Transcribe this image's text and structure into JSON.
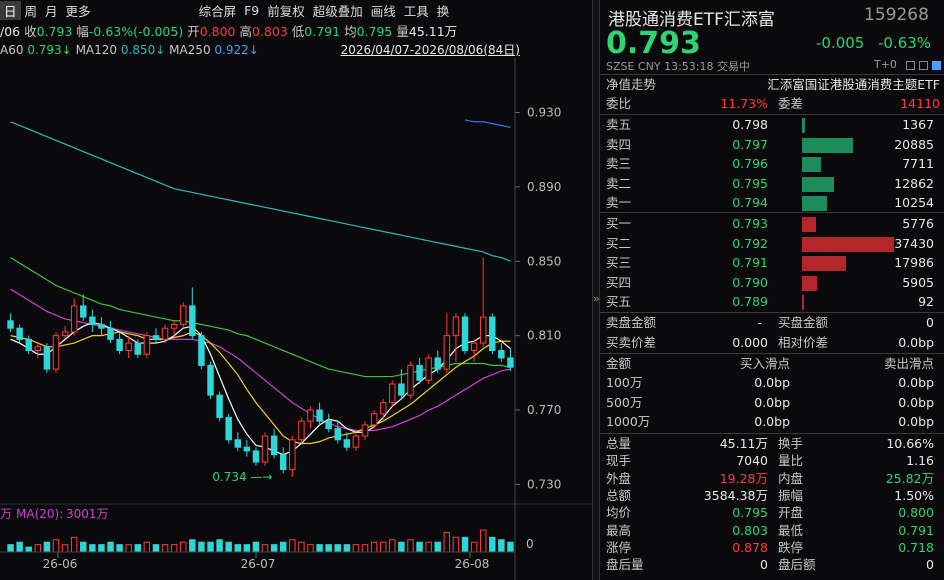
{
  "toolbar": {
    "period_day": "日",
    "period_week": "周",
    "period_month": "月",
    "more": "更多",
    "date_prefix": "/06",
    "close_label": "收",
    "close": "0.793",
    "change_label": "幅",
    "change": "-0.63%(-0.005)",
    "open_label": "开",
    "open": "0.800",
    "high_label": "高",
    "high": "0.803",
    "low_label": "低",
    "low": "0.791",
    "avg_label": "均",
    "avg": "0.795",
    "vol_label": "量",
    "vol": "45.11万",
    "swap": "换",
    "composite": "综合屏",
    "f9": "F9",
    "adjust": "前复权",
    "overlay": "超级叠加",
    "draw": "画线",
    "tools": "工具"
  },
  "ma": {
    "ma60_label": "A60",
    "ma60": "0.793↓",
    "ma120_label": "MA120",
    "ma120": "0.850↓",
    "ma250_label": "MA250",
    "ma250": "0.922↓",
    "range": "2026/04/07-2026/08/06(84日)"
  },
  "yaxis": [
    "0.930",
    "0.890",
    "0.850",
    "0.810",
    "0.770",
    "0.730"
  ],
  "low_marker": "0.734",
  "vol_panel": {
    "unit": "万",
    "ma_label": "MA(20):",
    "ma_value": "3001万",
    "zero": "0"
  },
  "xaxis": [
    "26-06",
    "26-07",
    "26-08"
  ],
  "colors": {
    "up": "#ff3b3b",
    "down": "#2ed7d7",
    "ma5": "#ffffff",
    "ma10": "#f5d020",
    "ma20": "#d040d0",
    "ma60": "#40c040",
    "ma120": "#30b8c0",
    "ma250": "#4070ff"
  },
  "chart_data": {
    "type": "candlestick",
    "ylim": [
      0.72,
      0.955
    ],
    "low": 0.734,
    "candles": [
      [
        0.818,
        0.822,
        0.812,
        0.814
      ],
      [
        0.814,
        0.816,
        0.806,
        0.808
      ],
      [
        0.808,
        0.81,
        0.8,
        0.802
      ],
      [
        0.802,
        0.806,
        0.798,
        0.804
      ],
      [
        0.804,
        0.806,
        0.79,
        0.792
      ],
      [
        0.792,
        0.812,
        0.79,
        0.81
      ],
      [
        0.81,
        0.815,
        0.808,
        0.812
      ],
      [
        0.812,
        0.83,
        0.81,
        0.826
      ],
      [
        0.826,
        0.832,
        0.818,
        0.82
      ],
      [
        0.82,
        0.824,
        0.812,
        0.816
      ],
      [
        0.816,
        0.82,
        0.81,
        0.814
      ],
      [
        0.814,
        0.818,
        0.806,
        0.808
      ],
      [
        0.808,
        0.812,
        0.8,
        0.802
      ],
      [
        0.802,
        0.81,
        0.798,
        0.806
      ],
      [
        0.806,
        0.808,
        0.798,
        0.8
      ],
      [
        0.8,
        0.812,
        0.798,
        0.81
      ],
      [
        0.81,
        0.814,
        0.806,
        0.808
      ],
      [
        0.808,
        0.816,
        0.806,
        0.814
      ],
      [
        0.814,
        0.818,
        0.81,
        0.816
      ],
      [
        0.816,
        0.828,
        0.814,
        0.826
      ],
      [
        0.826,
        0.836,
        0.808,
        0.81
      ],
      [
        0.81,
        0.812,
        0.792,
        0.794
      ],
      [
        0.794,
        0.796,
        0.776,
        0.778
      ],
      [
        0.778,
        0.78,
        0.764,
        0.766
      ],
      [
        0.766,
        0.768,
        0.752,
        0.754
      ],
      [
        0.754,
        0.758,
        0.748,
        0.75
      ],
      [
        0.75,
        0.754,
        0.745,
        0.748
      ],
      [
        0.748,
        0.75,
        0.74,
        0.742
      ],
      [
        0.742,
        0.758,
        0.74,
        0.756
      ],
      [
        0.756,
        0.76,
        0.744,
        0.746
      ],
      [
        0.746,
        0.75,
        0.736,
        0.738
      ],
      [
        0.738,
        0.756,
        0.734,
        0.754
      ],
      [
        0.754,
        0.766,
        0.752,
        0.764
      ],
      [
        0.764,
        0.772,
        0.76,
        0.77
      ],
      [
        0.77,
        0.774,
        0.762,
        0.764
      ],
      [
        0.764,
        0.768,
        0.758,
        0.76
      ],
      [
        0.76,
        0.764,
        0.752,
        0.754
      ],
      [
        0.754,
        0.758,
        0.748,
        0.75
      ],
      [
        0.75,
        0.758,
        0.748,
        0.756
      ],
      [
        0.756,
        0.764,
        0.754,
        0.762
      ],
      [
        0.762,
        0.77,
        0.76,
        0.768
      ],
      [
        0.768,
        0.776,
        0.764,
        0.774
      ],
      [
        0.774,
        0.786,
        0.772,
        0.784
      ],
      [
        0.784,
        0.792,
        0.776,
        0.778
      ],
      [
        0.778,
        0.796,
        0.776,
        0.794
      ],
      [
        0.794,
        0.798,
        0.784,
        0.786
      ],
      [
        0.786,
        0.8,
        0.784,
        0.798
      ],
      [
        0.798,
        0.802,
        0.79,
        0.792
      ],
      [
        0.792,
        0.822,
        0.79,
        0.81
      ],
      [
        0.81,
        0.822,
        0.796,
        0.82
      ],
      [
        0.82,
        0.822,
        0.8,
        0.802
      ],
      [
        0.802,
        0.808,
        0.796,
        0.806
      ],
      [
        0.806,
        0.852,
        0.804,
        0.82
      ],
      [
        0.82,
        0.822,
        0.8,
        0.802
      ],
      [
        0.802,
        0.806,
        0.796,
        0.798
      ],
      [
        0.798,
        0.803,
        0.791,
        0.793
      ]
    ],
    "ma5": [
      0.808,
      0.806,
      0.803,
      0.8,
      0.8,
      0.804,
      0.808,
      0.812,
      0.815,
      0.817,
      0.816,
      0.814,
      0.812,
      0.809,
      0.806,
      0.806,
      0.806,
      0.807,
      0.81,
      0.814,
      0.815,
      0.81,
      0.8,
      0.788,
      0.776,
      0.765,
      0.757,
      0.751,
      0.75,
      0.748,
      0.746,
      0.748,
      0.752,
      0.757,
      0.762,
      0.765,
      0.764,
      0.76,
      0.758,
      0.758,
      0.761,
      0.766,
      0.772,
      0.776,
      0.781,
      0.785,
      0.789,
      0.792,
      0.797,
      0.803,
      0.806,
      0.807,
      0.81,
      0.81,
      0.807,
      0.803
    ],
    "ma10": [
      0.81,
      0.809,
      0.808,
      0.806,
      0.804,
      0.804,
      0.805,
      0.806,
      0.808,
      0.81,
      0.81,
      0.811,
      0.812,
      0.811,
      0.81,
      0.808,
      0.808,
      0.808,
      0.809,
      0.81,
      0.812,
      0.81,
      0.806,
      0.801,
      0.795,
      0.789,
      0.781,
      0.774,
      0.768,
      0.762,
      0.756,
      0.753,
      0.752,
      0.752,
      0.753,
      0.755,
      0.756,
      0.757,
      0.758,
      0.76,
      0.762,
      0.764,
      0.767,
      0.77,
      0.773,
      0.777,
      0.781,
      0.785,
      0.789,
      0.793,
      0.796,
      0.799,
      0.803,
      0.806,
      0.807,
      0.807
    ],
    "ma20": [
      0.835,
      0.832,
      0.829,
      0.826,
      0.823,
      0.821,
      0.819,
      0.818,
      0.817,
      0.816,
      0.815,
      0.814,
      0.813,
      0.812,
      0.811,
      0.81,
      0.809,
      0.808,
      0.808,
      0.808,
      0.808,
      0.807,
      0.806,
      0.804,
      0.801,
      0.798,
      0.794,
      0.79,
      0.786,
      0.782,
      0.778,
      0.774,
      0.771,
      0.768,
      0.765,
      0.763,
      0.761,
      0.76,
      0.759,
      0.759,
      0.759,
      0.76,
      0.761,
      0.763,
      0.765,
      0.767,
      0.77,
      0.772,
      0.775,
      0.778,
      0.781,
      0.784,
      0.787,
      0.789,
      0.791,
      0.792
    ],
    "ma60": [
      0.852,
      0.849,
      0.846,
      0.843,
      0.84,
      0.837,
      0.835,
      0.833,
      0.831,
      0.829,
      0.827,
      0.826,
      0.824,
      0.823,
      0.822,
      0.821,
      0.82,
      0.819,
      0.818,
      0.818,
      0.817,
      0.816,
      0.815,
      0.814,
      0.813,
      0.811,
      0.81,
      0.808,
      0.806,
      0.804,
      0.802,
      0.8,
      0.798,
      0.796,
      0.794,
      0.792,
      0.791,
      0.79,
      0.789,
      0.788,
      0.788,
      0.788,
      0.788,
      0.789,
      0.79,
      0.791,
      0.792,
      0.793,
      0.794,
      0.795,
      0.795,
      0.795,
      0.795,
      0.794,
      0.794,
      0.793
    ],
    "ma120": [
      0.925,
      0.923,
      0.921,
      0.919,
      0.917,
      0.915,
      0.913,
      0.911,
      0.909,
      0.907,
      0.905,
      0.903,
      0.901,
      0.899,
      0.897,
      0.895,
      0.893,
      0.891,
      0.889,
      0.888,
      0.887,
      0.886,
      0.885,
      0.884,
      0.883,
      0.882,
      0.881,
      0.88,
      0.879,
      0.878,
      0.877,
      0.876,
      0.875,
      0.874,
      0.873,
      0.872,
      0.871,
      0.87,
      0.869,
      0.868,
      0.867,
      0.866,
      0.865,
      0.864,
      0.863,
      0.862,
      0.861,
      0.86,
      0.859,
      0.858,
      0.857,
      0.856,
      0.855,
      0.853,
      0.852,
      0.85
    ],
    "ma250": [
      0.926,
      0.925,
      0.925,
      0.924,
      0.923,
      0.922
    ],
    "volumes": [
      3,
      4,
      2,
      3,
      4,
      5,
      3,
      6,
      4,
      3,
      3,
      4,
      3,
      3,
      3,
      4,
      3,
      3,
      3,
      4,
      5,
      4,
      4,
      5,
      4,
      3,
      3,
      4,
      3,
      3,
      4,
      5,
      4,
      3,
      3,
      3,
      3,
      3,
      3,
      3,
      4,
      4,
      5,
      4,
      5,
      4,
      4,
      4,
      8,
      6,
      6,
      4,
      9,
      6,
      5,
      4
    ]
  },
  "quote": {
    "name": "港股通消费ETF汇添富",
    "code": "159268",
    "price": "0.793",
    "change": "-0.005",
    "pct": "-0.63%",
    "exch": "SZSE",
    "cur": "CNY",
    "time": "13:53:18",
    "status": "交易中",
    "tplus": "T+0",
    "nav_label": "净值走势",
    "fund_name": "汇添富国证港股通消费主题ETF",
    "webi_label": "委比",
    "webi": "11.73%",
    "weicha_label": "委差",
    "weicha": "14110"
  },
  "asks": [
    {
      "label": "卖五",
      "price": "0.798",
      "vol": "1367",
      "v": 1367
    },
    {
      "label": "卖四",
      "price": "0.797",
      "vol": "20885",
      "v": 20885
    },
    {
      "label": "卖三",
      "price": "0.796",
      "vol": "7711",
      "v": 7711
    },
    {
      "label": "卖二",
      "price": "0.795",
      "vol": "12862",
      "v": 12862
    },
    {
      "label": "卖一",
      "price": "0.794",
      "vol": "10254",
      "v": 10254
    }
  ],
  "bids": [
    {
      "label": "买一",
      "price": "0.793",
      "vol": "5776",
      "v": 5776
    },
    {
      "label": "买二",
      "price": "0.792",
      "vol": "37430",
      "v": 37430
    },
    {
      "label": "买三",
      "price": "0.791",
      "vol": "17986",
      "v": 17986
    },
    {
      "label": "买四",
      "price": "0.790",
      "vol": "5905",
      "v": 5905
    },
    {
      "label": "买五",
      "price": "0.789",
      "vol": "92",
      "v": 92
    }
  ],
  "amounts": {
    "sell_amt_label": "卖盘金额",
    "sell_amt": "-",
    "buy_amt_label": "买盘金额",
    "buy_amt": "0",
    "spread_label": "买卖价差",
    "spread": "0.000",
    "rel_spread_label": "相对价差",
    "rel_spread": "0.0bp"
  },
  "slip": {
    "h0": "金额",
    "h1": "买入滑点",
    "h2": "卖出滑点",
    "rows": [
      {
        "amt": "100万",
        "b": "0.0bp",
        "s": "0.0bp"
      },
      {
        "amt": "500万",
        "b": "0.0bp",
        "s": "0.0bp"
      },
      {
        "amt": "1000万",
        "b": "0.0bp",
        "s": "0.0bp"
      }
    ]
  },
  "stats": [
    {
      "l1": "总量",
      "v1": "45.11万",
      "c1": "white",
      "l2": "换手",
      "v2": "10.66%",
      "c2": "white"
    },
    {
      "l1": "现手",
      "v1": "7040",
      "c1": "white",
      "l2": "量比",
      "v2": "1.16",
      "c2": "white"
    },
    {
      "l1": "外盘",
      "v1": "19.28万",
      "c1": "red",
      "l2": "内盘",
      "v2": "25.82万",
      "c2": "green"
    },
    {
      "l1": "总额",
      "v1": "3584.38万",
      "c1": "white",
      "l2": "振幅",
      "v2": "1.50%",
      "c2": "white"
    },
    {
      "l1": "均价",
      "v1": "0.795",
      "c1": "green",
      "l2": "开盘",
      "v2": "0.800",
      "c2": "green"
    },
    {
      "l1": "最高",
      "v1": "0.803",
      "c1": "green",
      "l2": "最低",
      "v2": "0.791",
      "c2": "green"
    },
    {
      "l1": "涨停",
      "v1": "0.878",
      "c1": "red",
      "l2": "跌停",
      "v2": "0.718",
      "c2": "green"
    },
    {
      "l1": "盘后量",
      "v1": "0",
      "c1": "white",
      "l2": "盘后额",
      "v2": "0",
      "c2": "white"
    }
  ]
}
